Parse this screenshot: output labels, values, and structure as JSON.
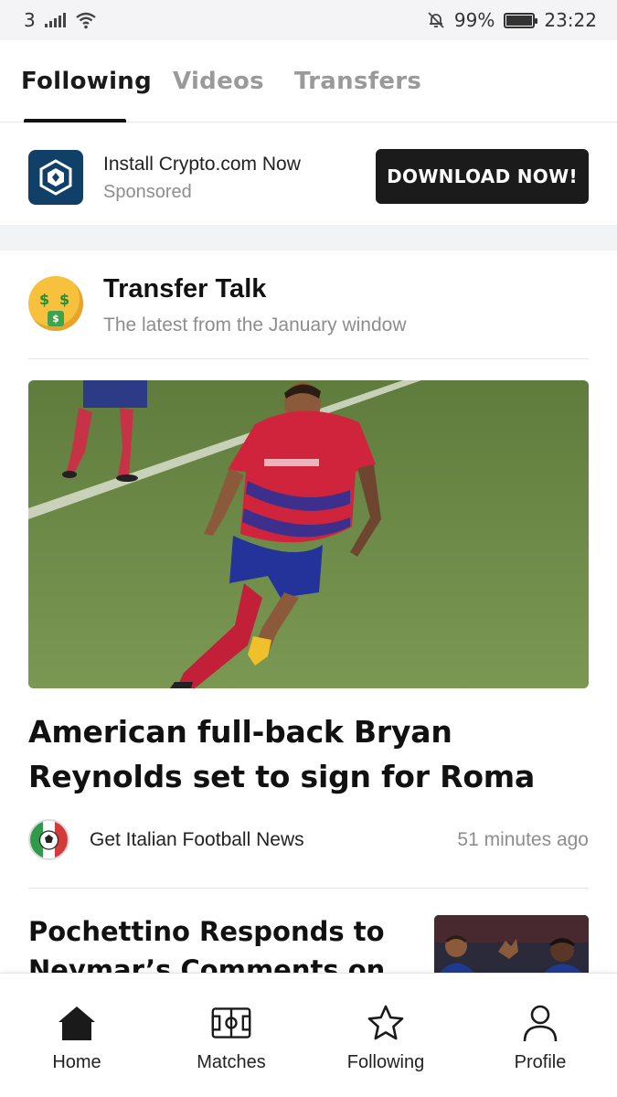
{
  "status_bar": {
    "carrier": "3",
    "battery": "99%",
    "time": "23:22",
    "icons": [
      "signal-icon",
      "wifi-icon",
      "bell-off-icon",
      "battery-icon"
    ]
  },
  "top_tabs": [
    {
      "label": "Following",
      "active": true
    },
    {
      "label": "Videos",
      "active": false
    },
    {
      "label": "Transfers",
      "active": false
    }
  ],
  "ad": {
    "title": "Install Crypto.com Now",
    "subtitle": "Sponsored",
    "button_label": "DOWNLOAD NOW!",
    "logo_icon": "crypto-com-logo-icon",
    "logo_color": "#103f68"
  },
  "section": {
    "title": "Transfer Talk",
    "subtitle": "The latest from the January window",
    "icon": "money-mouth-face-emoji"
  },
  "article": {
    "headline": "American full-back Bryan Reynolds set to sign for Roma",
    "source": "Get Italian Football News",
    "time": "51 minutes ago",
    "image": "player-running-on-pitch-photo"
  },
  "next_article": {
    "headline": "Pochettino Responds to Neymar’s Comments on",
    "image": "players-celebrating-photo"
  },
  "bottom_nav": [
    {
      "label": "Home",
      "icon": "home-icon",
      "active": true
    },
    {
      "label": "Matches",
      "icon": "pitch-icon",
      "active": false
    },
    {
      "label": "Following",
      "icon": "star-icon",
      "active": false
    },
    {
      "label": "Profile",
      "icon": "person-icon",
      "active": false
    }
  ],
  "colors": {
    "accent": "#111111",
    "muted_text": "#8d8d8d",
    "pitch_green": "#6f8b45",
    "kit_red": "#d0243c",
    "kit_blue": "#23339a"
  }
}
